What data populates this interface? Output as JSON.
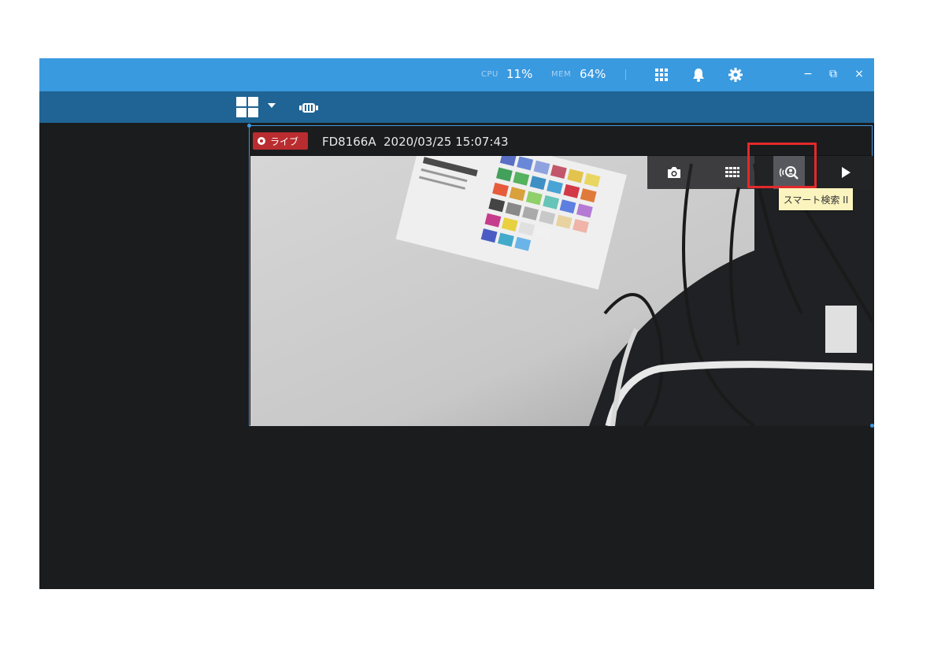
{
  "titlebar": {
    "cpu_label": "CPU",
    "cpu_value": "11%",
    "mem_label": "MEM",
    "mem_value": "64%",
    "icons": [
      "grid-apps-icon",
      "bell-icon",
      "gear-icon"
    ],
    "window_controls": {
      "minimize": "−",
      "restore": "⧉",
      "close": "×"
    }
  },
  "toolbar": {
    "layout_icon": "layout-2x2-icon",
    "layout_caret": "chevron-down-icon",
    "fisheye_icon": "fisheye-dewarp-icon"
  },
  "view": {
    "live_label": "ライブ",
    "camera_name": "FD8166A",
    "timestamp": "2020/03/25 15:07:43",
    "overlay_buttons": [
      "camera-snapshot-icon",
      "grid-icon",
      "smart-search-icon",
      "play-icon"
    ],
    "tooltip": "スマート検索 II"
  },
  "colors": {
    "titlebar": "#3a9ae0",
    "toolbar": "#1f6494",
    "app_bg": "#1b1c1e",
    "live_badge": "#b92c2f",
    "highlight": "#e3292b",
    "tooltip_bg": "#fbf4be"
  }
}
